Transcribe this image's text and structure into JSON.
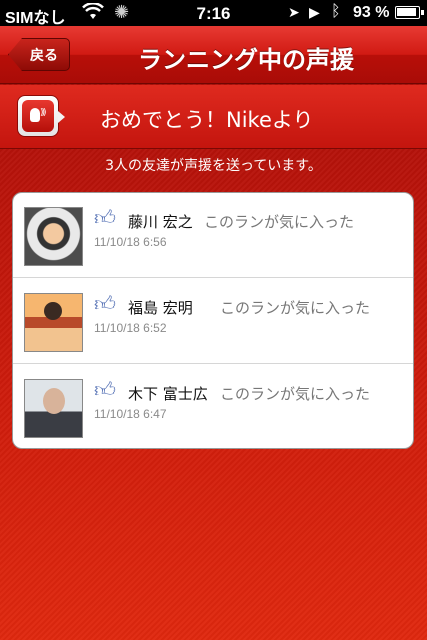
{
  "status_bar": {
    "carrier": "SIMなし",
    "time": "7:16",
    "battery": "93 %"
  },
  "nav": {
    "back_label": "戻る",
    "title": "ランニング中の声援"
  },
  "cheer": {
    "title": "おめでとう！Nikeより"
  },
  "count_text": "3人の友達が声援を送っています。",
  "cheers": [
    {
      "name": "藤川 宏之",
      "message": "このランが気に入った",
      "timestamp": "11/10/18 6:56"
    },
    {
      "name": "福島 宏明",
      "message": "このランが気に入った",
      "timestamp": "11/10/18 6:52"
    },
    {
      "name": "木下 富士広",
      "message": "このランが気に入った",
      "timestamp": "11/10/18 6:47"
    }
  ],
  "icons": [
    "wifi-icon",
    "activity-spinner-icon",
    "location-arrow-icon",
    "play-icon",
    "bluetooth-icon",
    "battery-icon",
    "cheer-speaker-icon",
    "like-thumb-icon"
  ],
  "colors": {
    "accent": "#c0110b",
    "like": "#5c77b8"
  }
}
